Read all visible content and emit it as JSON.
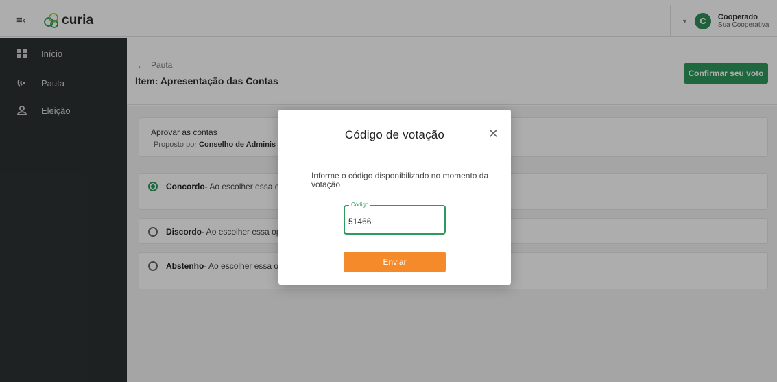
{
  "brand": {
    "name": "curia",
    "accent": "#2e9a5d",
    "logo_color_1": "#2e9a5d",
    "logo_color_2": "#8cc63f"
  },
  "header": {
    "menu_icon": "menu-collapse-icon",
    "user": {
      "initial": "C",
      "name": "Cooperado",
      "org": "Sua Cooperativa",
      "avatar_color": "#2e8f5a"
    }
  },
  "sidebar": {
    "items": [
      {
        "label": "Início",
        "icon": "dashboard-icon"
      },
      {
        "label": "Pauta",
        "icon": "agenda-icon"
      },
      {
        "label": "Eleição",
        "icon": "election-icon"
      }
    ]
  },
  "main": {
    "back_label": "Pauta",
    "title": "Item: Apresentação das Contas",
    "confirm_button": "Confirmar seu voto",
    "confirm_color": "#2e9a5d"
  },
  "proposal": {
    "title": "Aprovar as contas",
    "proposed_prefix": "Proposto por",
    "proposed_by": "Conselho de Adminis"
  },
  "options": [
    {
      "label": "Concordo",
      "desc": "- Ao escolher essa op",
      "checked": true
    },
    {
      "label": "Discordo",
      "desc": "- Ao escolher essa opç",
      "checked": false
    },
    {
      "label": "Abstenho",
      "desc": "- Ao escolher essa op",
      "checked": false
    }
  ],
  "modal": {
    "title": "Código de votação",
    "description": "Informe o código disponibilizado no momento da votação",
    "field_label": "Código",
    "field_value": "51466",
    "submit": "Enviar",
    "submit_color": "#f58a2a"
  }
}
